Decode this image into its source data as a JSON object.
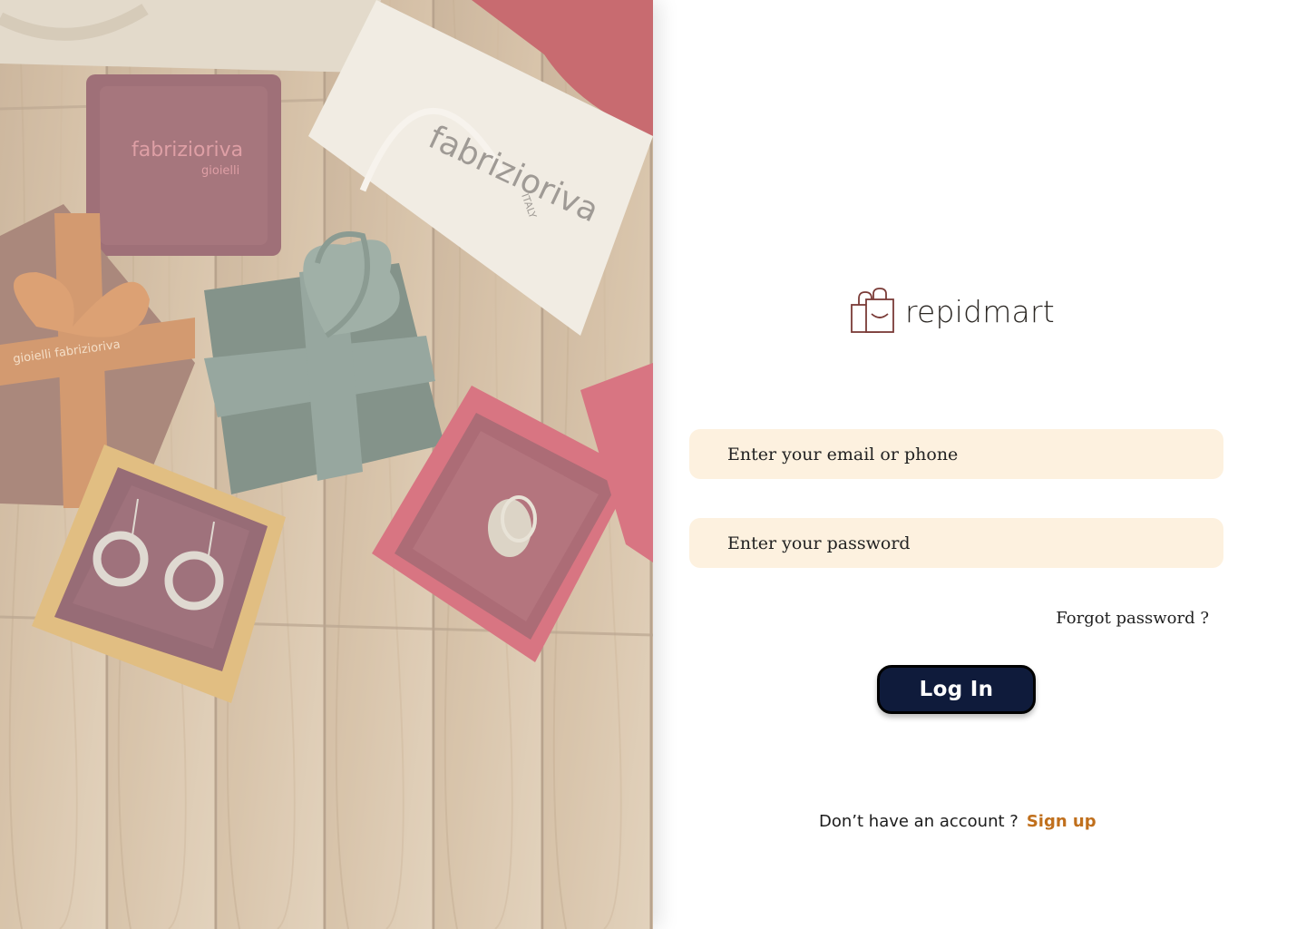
{
  "brand": {
    "name": "repidmart"
  },
  "login": {
    "email_placeholder": "Enter your email or phone",
    "password_placeholder": "Enter your password",
    "forgot_label": "Forgot password ?",
    "login_label": "Log In",
    "no_account_text": "Don’t have an account ?",
    "signup_label": "Sign up"
  },
  "hero": {
    "box_brand": "fabrizioriva",
    "box_sub": "gioielli",
    "bag_country": "ITALY",
    "ribbon_text": "gioielli fabrizioriva"
  },
  "colors": {
    "field_bg": "#fdf1df",
    "button_bg": "#0f1b3b",
    "signup_link": "#c06f1c"
  }
}
